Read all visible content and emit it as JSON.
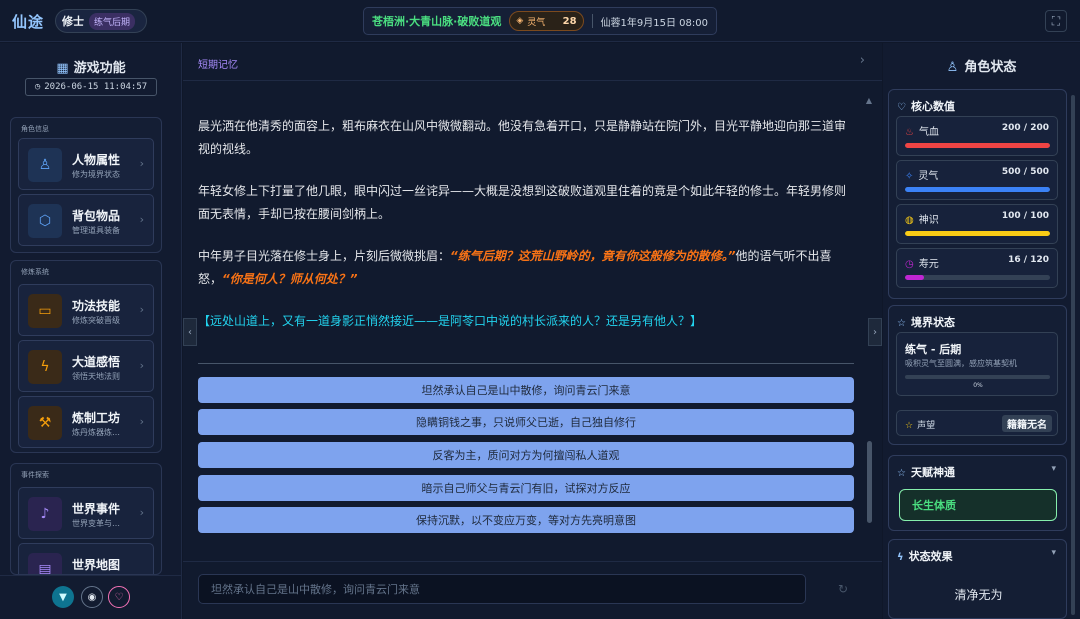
{
  "topbar": {
    "logo": "仙途",
    "role": "修士",
    "realm_badge": "练气后期",
    "location": "苍梧洲·大青山脉·破败道观",
    "qi_label": "灵气",
    "qi_value": "28",
    "game_time": "仙蓉1年9月15日 08:00"
  },
  "left": {
    "title": "游戏功能",
    "datetime": "2026-06-15 11:04:57",
    "groups": [
      {
        "label": "角色信息",
        "items": [
          {
            "title": "人物属性",
            "sub": "修为境界状态",
            "icon": "person-icon",
            "color": "#60a5fa"
          },
          {
            "title": "背包物品",
            "sub": "管理道具装备",
            "icon": "cube-icon",
            "color": "#60a5fa"
          }
        ]
      },
      {
        "label": "修炼系统",
        "items": [
          {
            "title": "功法技能",
            "sub": "修炼突破晋级",
            "icon": "book-icon",
            "color": "#f59e0b"
          },
          {
            "title": "大道感悟",
            "sub": "领悟天地法则",
            "icon": "bolt-icon",
            "color": "#f59e0b"
          },
          {
            "title": "炼制工坊",
            "sub": "炼丹炼器炼…",
            "icon": "hammer-icon",
            "color": "#f59e0b"
          }
        ]
      },
      {
        "label": "事件探索",
        "items": [
          {
            "title": "世界事件",
            "sub": "世界变革与…",
            "icon": "bell-icon",
            "color": "#a78bfa"
          },
          {
            "title": "世界地图",
            "sub": "",
            "icon": "map-icon",
            "color": "#a78bfa"
          }
        ]
      }
    ]
  },
  "main": {
    "memory_label": "短期记忆",
    "p1": "晨光洒在他清秀的面容上，粗布麻衣在山风中微微翻动。他没有急着开口，只是静静站在院门外，目光平静地迎向那三道审视的视线。",
    "p2": "年轻女修上下打量了他几眼，眼中闪过一丝诧异——大概是没想到这破败道观里住着的竟是个如此年轻的修士。年轻男修则面无表情，手却已按在腰间剑柄上。",
    "p3_a": "中年男子目光落在修士身上，片刻后微微挑眉：",
    "p3_q1": "“练气后期？这荒山野岭的，竟有你这般修为的散修。”",
    "p3_b": "他的语气听不出喜怒，",
    "p3_q2": "“你是何人？师从何处？”",
    "p4": "【远处山道上，又有一道身影正悄然接近——是阿苓口中说的村长派来的人？还是另有他人？】",
    "choices": [
      "坦然承认自己是山中散修，询问青云门来意",
      "隐瞒铜钱之事，只说师父已逝，自己独自修行",
      "反客为主，质问对方为何擅闯私人道观",
      "暗示自己师父与青云门有旧，试探对方反应",
      "保持沉默，以不变应万变，等对方先亮明意图"
    ],
    "input_placeholder": "坦然承认自己是山中散修，询问青云门来意"
  },
  "right": {
    "title": "角色状态",
    "core_title": "核心数值",
    "stats": [
      {
        "name": "气血",
        "value": "200 / 200",
        "ratio": 1.0,
        "color": "#ef4444",
        "icon": "blood-icon"
      },
      {
        "name": "灵气",
        "value": "500 / 500",
        "ratio": 1.0,
        "color": "#3b82f6",
        "icon": "spirit-icon"
      },
      {
        "name": "神识",
        "value": "100 / 100",
        "ratio": 1.0,
        "color": "#facc15",
        "icon": "mind-icon"
      },
      {
        "name": "寿元",
        "value": "16 / 120",
        "ratio": 0.133,
        "color": "#c026d3",
        "icon": "clock-icon"
      }
    ],
    "realm_title": "境界状态",
    "realm_name": "练气 - 后期",
    "realm_desc": "吸积灵气至圆满，感应筑基契机",
    "realm_pct": "0%",
    "realm_ratio": 0,
    "fame_label": "声望",
    "fame_value": "籍籍无名",
    "talent_title": "天赋神通",
    "talent_value": "长生体质",
    "status_title": "状态效果",
    "status_value": "清净无为"
  }
}
